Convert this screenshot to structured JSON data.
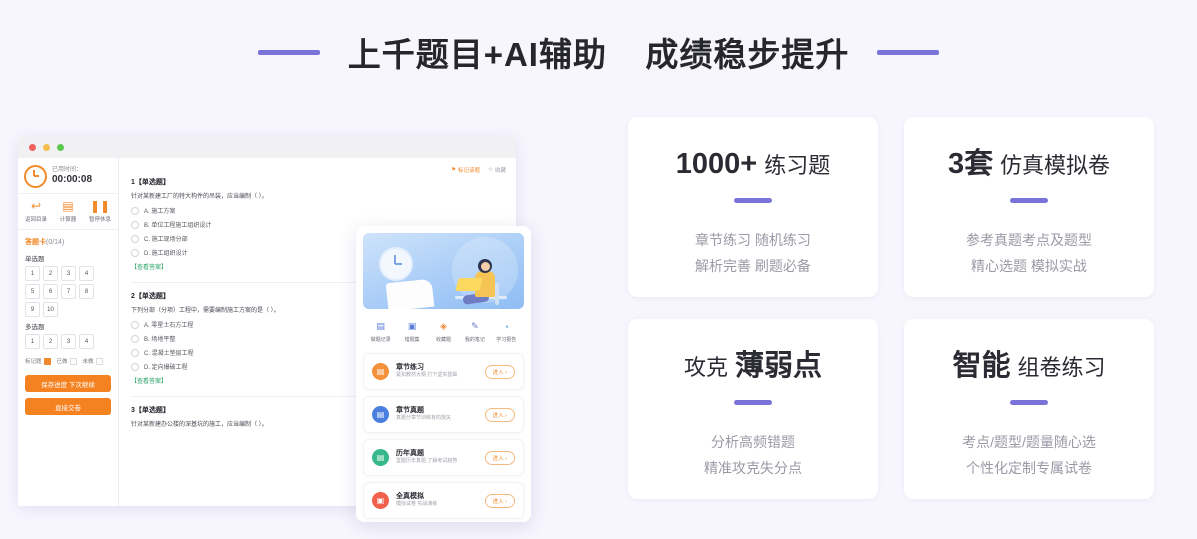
{
  "header": {
    "title_strong": "上千题目+AI辅助",
    "title_second": "成绩稳步提升",
    "accent_color": "#7b74d8"
  },
  "cards": [
    {
      "strong": "1000+",
      "light": "练习题",
      "sub1": "章节练习 随机练习",
      "sub2": "解析完善 刷题必备"
    },
    {
      "strong": "3套",
      "light": "仿真模拟卷",
      "sub1": "参考真题考点及题型",
      "sub2": "精心选题 模拟实战"
    },
    {
      "strong": "薄弱点",
      "light": "攻克",
      "sub1": "分析高频错题",
      "sub2": "精准攻克失分点"
    },
    {
      "strong": "智能",
      "light": "组卷练习",
      "sub1": "考点/题型/题量随心选",
      "sub2": "个性化定制专属试卷"
    }
  ],
  "browser": {
    "timer": {
      "icon": "clock-icon",
      "label": "已用时间：",
      "value": "00:00:08"
    },
    "tools": [
      {
        "icon": "back-arrow-icon",
        "label": "返回目录",
        "glyph": "↩"
      },
      {
        "icon": "calculator-icon",
        "label": "计算器",
        "glyph": "▤"
      },
      {
        "icon": "pause-icon",
        "label": "暂停休息",
        "glyph": "❚❚"
      }
    ],
    "answer_sheet": {
      "title": "答题卡",
      "count": "(0/14)",
      "groups": [
        {
          "label": "单选题",
          "numbers": [
            "1",
            "2",
            "3",
            "4",
            "5",
            "6",
            "7",
            "8",
            "9",
            "10"
          ]
        },
        {
          "label": "多选题",
          "numbers": [
            "1",
            "2",
            "3",
            "4"
          ]
        }
      ],
      "legend": [
        {
          "label": "标记题",
          "state": "mark"
        },
        {
          "label": "已做",
          "state": "done"
        },
        {
          "label": "未做",
          "state": "undone"
        }
      ]
    },
    "buttons": [
      {
        "label": "保存进度 下次继续"
      },
      {
        "label": "直接交卷"
      }
    ],
    "question_tools": [
      {
        "icon": "flag-icon",
        "label": "标记该题",
        "glyph": "⚑"
      },
      {
        "icon": "star-icon",
        "label": "收藏",
        "glyph": "☆"
      }
    ],
    "questions": [
      {
        "title": "1【单选题】",
        "stem": "针对某新建工厂的特大构件的吊装，应当编制（ ）。",
        "options": [
          "A. 施工方案",
          "B. 单位工程施工组织设计",
          "C. 施工现场分部",
          "D. 施工组织设计"
        ],
        "answer_link": "【查看答案】"
      },
      {
        "title": "2【单选题】",
        "stem": "下列分部（分项）工程中，需要编制施工方案的是（ ）。",
        "options": [
          "A. 零星土石方工程",
          "B. 场地平整",
          "C. 混凝土垫层工程",
          "D. 定向爆破工程"
        ],
        "answer_link": "【查看答案】"
      },
      {
        "title": "3【单选题】",
        "stem": "针对某新建办公楼的深基坑的施工，应当编制（ ）。",
        "options": [],
        "answer_link": ""
      }
    ]
  },
  "phone": {
    "hero": {
      "icon": "study-illustration",
      "clock": "wall-clock-icon"
    },
    "quick_menu": [
      {
        "icon": "record-icon",
        "label": "做题记录",
        "glyph": "▤"
      },
      {
        "icon": "wrong-set-icon",
        "label": "错题集",
        "glyph": "▣"
      },
      {
        "icon": "favorite-icon",
        "label": "收藏题",
        "glyph": "◈"
      },
      {
        "icon": "note-icon",
        "label": "我的笔记",
        "glyph": "✎"
      },
      {
        "icon": "report-icon",
        "label": "学习报告",
        "glyph": "◔"
      }
    ],
    "list": [
      {
        "icon": "chapter-practice-icon",
        "color": "#f5903c",
        "title": "章节练习",
        "subtitle": "紧扣教材大纲 打下坚实基础",
        "button": "进入 ›"
      },
      {
        "icon": "chapter-exam-icon",
        "color": "#4a7fe0",
        "title": "章节真题",
        "subtitle": "真题分章节训练有的放矢",
        "button": "进入 ›"
      },
      {
        "icon": "past-exam-icon",
        "color": "#37b88b",
        "title": "历年真题",
        "subtitle": "堂握历年真题 了解考试趋势",
        "button": "进入 ›"
      },
      {
        "icon": "mock-exam-icon",
        "color": "#f0604d",
        "title": "全真模拟",
        "subtitle": "模拟试卷 实战演练",
        "button": "进入 ›"
      }
    ]
  }
}
